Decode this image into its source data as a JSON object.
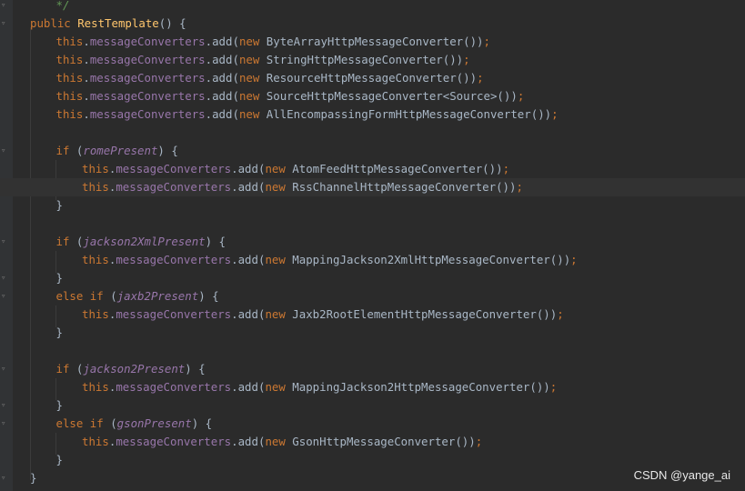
{
  "editor": {
    "lines": [
      {
        "indent": 1,
        "tokens": [
          {
            "t": "*/",
            "c": "cm"
          }
        ]
      },
      {
        "indent": 0,
        "tokens": [
          {
            "t": "public ",
            "c": "kw"
          },
          {
            "t": "RestTemplate",
            "c": "fn"
          },
          {
            "t": "() {",
            "c": "plain"
          }
        ]
      },
      {
        "indent": 1,
        "tokens": [
          {
            "t": "this",
            "c": "kw"
          },
          {
            "t": ".",
            "c": "plain"
          },
          {
            "t": "messageConverters",
            "c": "fld"
          },
          {
            "t": ".add(",
            "c": "plain"
          },
          {
            "t": "new ",
            "c": "kw"
          },
          {
            "t": "ByteArrayHttpMessageConverter())",
            "c": "plain"
          },
          {
            "t": ";",
            "c": "kw"
          }
        ]
      },
      {
        "indent": 1,
        "tokens": [
          {
            "t": "this",
            "c": "kw"
          },
          {
            "t": ".",
            "c": "plain"
          },
          {
            "t": "messageConverters",
            "c": "fld"
          },
          {
            "t": ".add(",
            "c": "plain"
          },
          {
            "t": "new ",
            "c": "kw"
          },
          {
            "t": "StringHttpMessageConverter())",
            "c": "plain"
          },
          {
            "t": ";",
            "c": "kw"
          }
        ]
      },
      {
        "indent": 1,
        "tokens": [
          {
            "t": "this",
            "c": "kw"
          },
          {
            "t": ".",
            "c": "plain"
          },
          {
            "t": "messageConverters",
            "c": "fld"
          },
          {
            "t": ".add(",
            "c": "plain"
          },
          {
            "t": "new ",
            "c": "kw"
          },
          {
            "t": "ResourceHttpMessageConverter())",
            "c": "plain"
          },
          {
            "t": ";",
            "c": "kw"
          }
        ]
      },
      {
        "indent": 1,
        "tokens": [
          {
            "t": "this",
            "c": "kw"
          },
          {
            "t": ".",
            "c": "plain"
          },
          {
            "t": "messageConverters",
            "c": "fld"
          },
          {
            "t": ".add(",
            "c": "plain"
          },
          {
            "t": "new ",
            "c": "kw"
          },
          {
            "t": "SourceHttpMessageConverter<Source>())",
            "c": "plain"
          },
          {
            "t": ";",
            "c": "kw"
          }
        ]
      },
      {
        "indent": 1,
        "tokens": [
          {
            "t": "this",
            "c": "kw"
          },
          {
            "t": ".",
            "c": "plain"
          },
          {
            "t": "messageConverters",
            "c": "fld"
          },
          {
            "t": ".add(",
            "c": "plain"
          },
          {
            "t": "new ",
            "c": "kw"
          },
          {
            "t": "AllEncompassingFormHttpMessageConverter())",
            "c": "plain"
          },
          {
            "t": ";",
            "c": "kw"
          }
        ]
      },
      {
        "indent": 0,
        "tokens": []
      },
      {
        "indent": 1,
        "tokens": [
          {
            "t": "if ",
            "c": "kw"
          },
          {
            "t": "(",
            "c": "plain"
          },
          {
            "t": "romePresent",
            "c": "ital"
          },
          {
            "t": ") {",
            "c": "plain"
          }
        ]
      },
      {
        "indent": 2,
        "tokens": [
          {
            "t": "this",
            "c": "kw"
          },
          {
            "t": ".",
            "c": "plain"
          },
          {
            "t": "messageConverters",
            "c": "fld"
          },
          {
            "t": ".add(",
            "c": "plain"
          },
          {
            "t": "new ",
            "c": "kw"
          },
          {
            "t": "AtomFeedHttpMessageConverter())",
            "c": "plain"
          },
          {
            "t": ";",
            "c": "kw"
          }
        ]
      },
      {
        "indent": 2,
        "highlight": true,
        "tokens": [
          {
            "t": "this",
            "c": "kw"
          },
          {
            "t": ".",
            "c": "plain"
          },
          {
            "t": "messageConverters",
            "c": "fld"
          },
          {
            "t": ".add(",
            "c": "plain"
          },
          {
            "t": "new ",
            "c": "kw"
          },
          {
            "t": "RssChannelHttpMessageConverter())",
            "c": "plain"
          },
          {
            "t": ";",
            "c": "kw"
          }
        ]
      },
      {
        "indent": 1,
        "tokens": [
          {
            "t": "}",
            "c": "plain"
          }
        ]
      },
      {
        "indent": 0,
        "tokens": []
      },
      {
        "indent": 1,
        "tokens": [
          {
            "t": "if ",
            "c": "kw"
          },
          {
            "t": "(",
            "c": "plain"
          },
          {
            "t": "jackson2XmlPresent",
            "c": "ital"
          },
          {
            "t": ") {",
            "c": "plain"
          }
        ]
      },
      {
        "indent": 2,
        "tokens": [
          {
            "t": "this",
            "c": "kw"
          },
          {
            "t": ".",
            "c": "plain"
          },
          {
            "t": "messageConverters",
            "c": "fld"
          },
          {
            "t": ".add(",
            "c": "plain"
          },
          {
            "t": "new ",
            "c": "kw"
          },
          {
            "t": "MappingJackson2XmlHttpMessageConverter())",
            "c": "plain"
          },
          {
            "t": ";",
            "c": "kw"
          }
        ]
      },
      {
        "indent": 1,
        "tokens": [
          {
            "t": "}",
            "c": "plain"
          }
        ]
      },
      {
        "indent": 1,
        "tokens": [
          {
            "t": "else if ",
            "c": "kw"
          },
          {
            "t": "(",
            "c": "plain"
          },
          {
            "t": "jaxb2Present",
            "c": "ital"
          },
          {
            "t": ") {",
            "c": "plain"
          }
        ]
      },
      {
        "indent": 2,
        "tokens": [
          {
            "t": "this",
            "c": "kw"
          },
          {
            "t": ".",
            "c": "plain"
          },
          {
            "t": "messageConverters",
            "c": "fld"
          },
          {
            "t": ".add(",
            "c": "plain"
          },
          {
            "t": "new ",
            "c": "kw"
          },
          {
            "t": "Jaxb2RootElementHttpMessageConverter())",
            "c": "plain"
          },
          {
            "t": ";",
            "c": "kw"
          }
        ]
      },
      {
        "indent": 1,
        "tokens": [
          {
            "t": "}",
            "c": "plain"
          }
        ]
      },
      {
        "indent": 0,
        "tokens": []
      },
      {
        "indent": 1,
        "tokens": [
          {
            "t": "if ",
            "c": "kw"
          },
          {
            "t": "(",
            "c": "plain"
          },
          {
            "t": "jackson2Present",
            "c": "ital"
          },
          {
            "t": ") {",
            "c": "plain"
          }
        ]
      },
      {
        "indent": 2,
        "tokens": [
          {
            "t": "this",
            "c": "kw"
          },
          {
            "t": ".",
            "c": "plain"
          },
          {
            "t": "messageConverters",
            "c": "fld"
          },
          {
            "t": ".add(",
            "c": "plain"
          },
          {
            "t": "new ",
            "c": "kw"
          },
          {
            "t": "MappingJackson2HttpMessageConverter())",
            "c": "plain"
          },
          {
            "t": ";",
            "c": "kw"
          }
        ]
      },
      {
        "indent": 1,
        "tokens": [
          {
            "t": "}",
            "c": "plain"
          }
        ]
      },
      {
        "indent": 1,
        "tokens": [
          {
            "t": "else if ",
            "c": "kw"
          },
          {
            "t": "(",
            "c": "plain"
          },
          {
            "t": "gsonPresent",
            "c": "ital"
          },
          {
            "t": ") {",
            "c": "plain"
          }
        ]
      },
      {
        "indent": 2,
        "tokens": [
          {
            "t": "this",
            "c": "kw"
          },
          {
            "t": ".",
            "c": "plain"
          },
          {
            "t": "messageConverters",
            "c": "fld"
          },
          {
            "t": ".add(",
            "c": "plain"
          },
          {
            "t": "new ",
            "c": "kw"
          },
          {
            "t": "GsonHttpMessageConverter())",
            "c": "plain"
          },
          {
            "t": ";",
            "c": "kw"
          }
        ]
      },
      {
        "indent": 1,
        "tokens": [
          {
            "t": "}",
            "c": "plain"
          }
        ]
      },
      {
        "indent": 0,
        "tokens": [
          {
            "t": "}",
            "c": "plain"
          }
        ]
      }
    ]
  },
  "watermark": "CSDN @yange_ai",
  "colors": {
    "background": "#2b2b2b",
    "keyword": "#cc7832",
    "field": "#9876aa",
    "method": "#ffc66d",
    "comment": "#629755",
    "text": "#a9b7c6",
    "current_line": "#323232"
  }
}
